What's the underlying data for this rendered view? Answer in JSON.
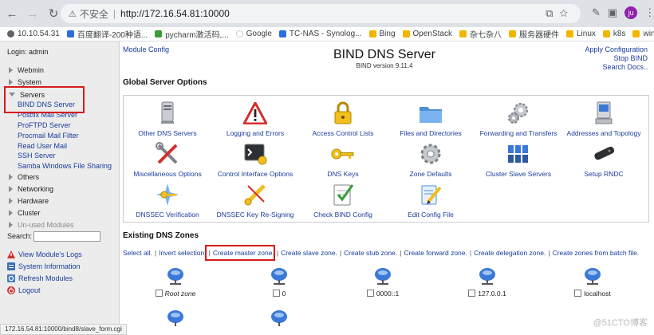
{
  "browser": {
    "insecure_label": "不安全",
    "url": "http://172.16.54.81:10000",
    "avatar_initials": "ju",
    "bookmarks": [
      "10.10.54.31",
      "百度翻译-200种语...",
      "pycharm激活码,...",
      "Google",
      "TC-NAS - Synolog...",
      "Bing",
      "OpenStack",
      "杂七杂八",
      "服务器硬件",
      "Linux",
      "k8s",
      "windows"
    ]
  },
  "sidebar": {
    "login": "Login: admin",
    "categories": {
      "webmin": "Webmin",
      "system": "System",
      "servers": "Servers",
      "others": "Others",
      "networking": "Networking",
      "hardware": "Hardware",
      "cluster": "Cluster",
      "unused": "Un-used Modules"
    },
    "server_modules": [
      "BIND DNS Server",
      "Postfix Mail Server",
      "ProFTPD Server",
      "Procmail Mail Filter",
      "Read User Mail",
      "SSH Server",
      "Samba Windows File Sharing"
    ],
    "search_label": "Search:",
    "links": {
      "view_logs": "View Module's Logs",
      "system_info": "System Information",
      "refresh_modules": "Refresh Modules",
      "logout": "Logout"
    }
  },
  "header": {
    "module_config": "Module Config",
    "title": "BIND DNS Server",
    "version": "BIND version 9.11.4",
    "apply_config": "Apply Configuration",
    "stop_bind": "Stop BIND",
    "search_docs": "Search Docs.."
  },
  "global_options": {
    "heading": "Global Server Options",
    "items": [
      "Other DNS Servers",
      "Logging and Errors",
      "Access Control Lists",
      "Files and Directories",
      "Forwarding and Transfers",
      "Addresses and Topology",
      "Miscellaneous Options",
      "Control Interface Options",
      "DNS Keys",
      "Zone Defaults",
      "Cluster Slave Servers",
      "Setup RNDC",
      "DNSSEC Verification",
      "DNSSEC Key Re-Signing",
      "Check BIND Config",
      "Edit Config File"
    ]
  },
  "zones": {
    "heading": "Existing DNS Zones",
    "links": [
      "Select all.",
      "Invert selection.",
      "Create master zone.",
      "Create slave zone.",
      "Create stub zone.",
      "Create forward zone.",
      "Create delegation zone.",
      "Create zones from batch file."
    ],
    "items": [
      "Root zone",
      "0",
      "0000::1",
      "127.0.0.1",
      "localhost"
    ]
  },
  "status_bar": "172.16.54.81:10000/bind8/slave_form.cgi",
  "watermark": "@51CTO博客",
  "colors": {
    "link": "#1a3d9c",
    "highlight_box": "#d81b1b",
    "sidebar_bg": "#ececec"
  }
}
